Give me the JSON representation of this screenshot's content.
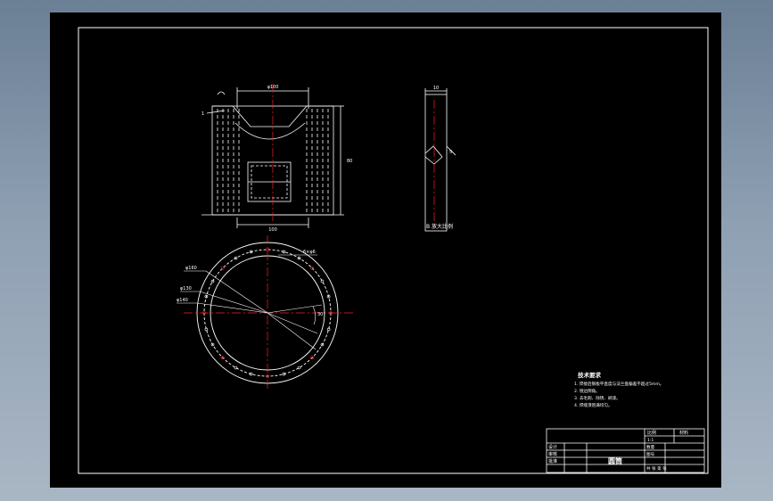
{
  "colors": {
    "background": "#8fa0b3",
    "sheet": "#000000",
    "lines": "#ffffff",
    "centerlines": "#ff2020",
    "dimensions": "#ffffff"
  },
  "front_view": {
    "top_width_dim": "φ100",
    "bottom_width_dim": "100",
    "height_dim": "80",
    "leader_label": "1"
  },
  "side_view": {
    "top_dim": "10",
    "slot_dim": "5",
    "caption": "B 放大比例"
  },
  "plan_view": {
    "dim_outer": "φ160",
    "dim_mid": "φ130",
    "dim_inner": "φ140",
    "dim_holes": "6×φ6",
    "dim_angle": "30°"
  },
  "notes": {
    "title": "技术要求",
    "items": [
      "1. 焊接后钢板平直度与法兰盘偏差不超过5mm。",
      "2. 锐边倒角。",
      "3. 去毛刺、除锈、刷漆。",
      "4. 焊缝须饱满均匀。"
    ]
  },
  "title_block": {
    "part_name": "圆筒",
    "label_design": "设计",
    "label_check": "审核",
    "label_approve": "批准",
    "label_scale": "比例",
    "label_scale_value": "1:1",
    "label_material": "材料",
    "label_weight": "数量",
    "label_drawing_no": "图号",
    "sheet_info": "共 张  第 张"
  }
}
